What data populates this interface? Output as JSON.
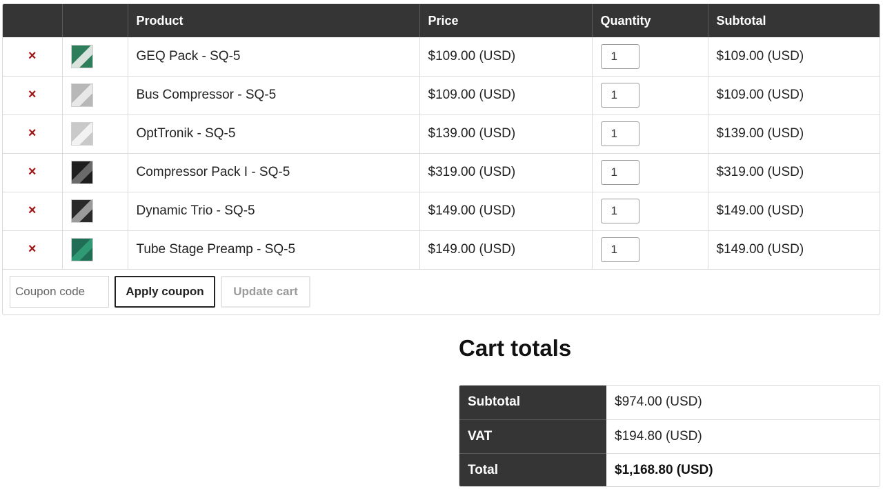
{
  "cart": {
    "headers": {
      "remove": "",
      "thumbnail": "",
      "product": "Product",
      "price": "Price",
      "quantity": "Quantity",
      "subtotal": "Subtotal"
    },
    "remove_icon": "×",
    "items": [
      {
        "name": "GEQ Pack - SQ-5",
        "price": "$109.00 (USD)",
        "quantity": "1",
        "subtotal": "$109.00 (USD)",
        "thumb_colors": [
          "#2e7d5b",
          "#d9e2dc"
        ]
      },
      {
        "name": "Bus Compressor - SQ-5",
        "price": "$109.00 (USD)",
        "quantity": "1",
        "subtotal": "$109.00 (USD)",
        "thumb_colors": [
          "#b8b8b8",
          "#e8e8e8"
        ]
      },
      {
        "name": "OptTronik - SQ-5",
        "price": "$139.00 (USD)",
        "quantity": "1",
        "subtotal": "$139.00 (USD)",
        "thumb_colors": [
          "#c9c9c9",
          "#f2f2f2"
        ]
      },
      {
        "name": "Compressor Pack I - SQ-5",
        "price": "$319.00 (USD)",
        "quantity": "1",
        "subtotal": "$319.00 (USD)",
        "thumb_colors": [
          "#1e1e1e",
          "#6a6a6a"
        ]
      },
      {
        "name": "Dynamic Trio - SQ-5",
        "price": "$149.00 (USD)",
        "quantity": "1",
        "subtotal": "$149.00 (USD)",
        "thumb_colors": [
          "#2a2a2a",
          "#9a9a9a"
        ]
      },
      {
        "name": "Tube Stage Preamp - SQ-5",
        "price": "$149.00 (USD)",
        "quantity": "1",
        "subtotal": "$149.00 (USD)",
        "thumb_colors": [
          "#1f6e55",
          "#2f9a74"
        ]
      }
    ],
    "coupon_placeholder": "Coupon code",
    "apply_coupon_label": "Apply coupon",
    "update_cart_label": "Update cart"
  },
  "totals": {
    "title": "Cart totals",
    "rows": [
      {
        "label": "Subtotal",
        "value": "$974.00 (USD)"
      },
      {
        "label": "VAT",
        "value": "$194.80 (USD)"
      },
      {
        "label": "Total",
        "value": "$1,168.80 (USD)"
      }
    ]
  },
  "colors": {
    "header_bg": "#353535",
    "remove_icon": "#a01414"
  }
}
